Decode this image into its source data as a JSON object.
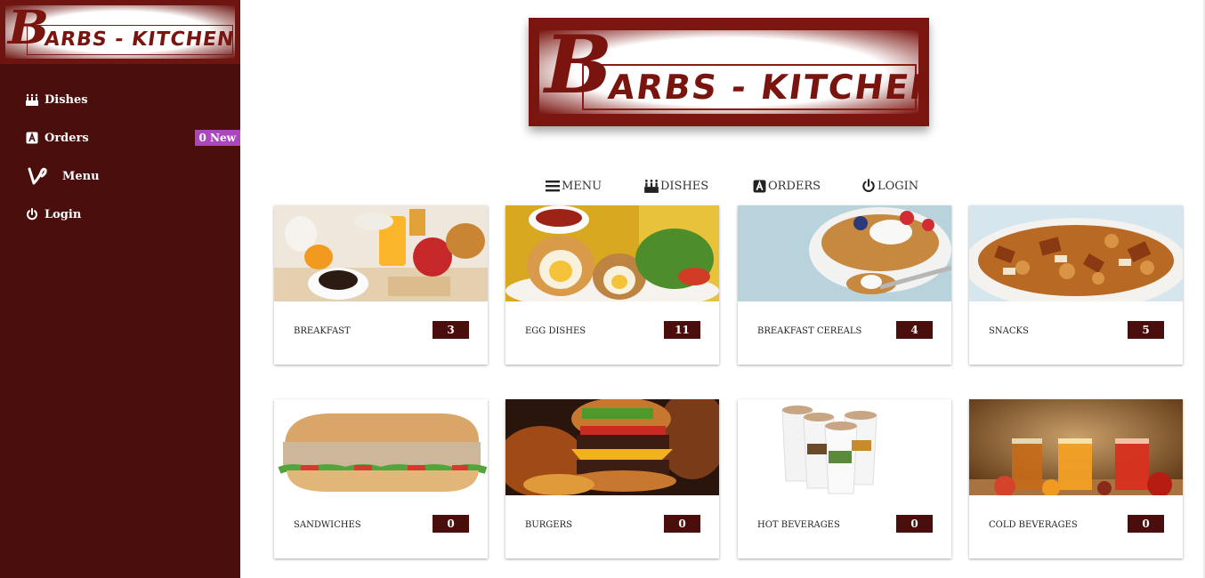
{
  "sidebar": {
    "logo": {
      "letter": "B",
      "text": "ARBS - KITCHEN"
    },
    "items": [
      {
        "label": "Dishes",
        "icon": "birthday-cake-icon"
      },
      {
        "label": "Orders",
        "icon": "letter-a-box-icon",
        "badge": "0 New"
      },
      {
        "label": "Menu",
        "icon": "vine-icon"
      },
      {
        "label": "Login",
        "icon": "power-icon"
      }
    ]
  },
  "header": {
    "logo": {
      "letter": "B",
      "text": "ARBS - KITCHEN"
    }
  },
  "nav": {
    "items": [
      {
        "label": "MENU",
        "icon": "hamburger-icon"
      },
      {
        "label": "DISHES",
        "icon": "birthday-cake-icon"
      },
      {
        "label": "ORDERS",
        "icon": "letter-a-box-icon"
      },
      {
        "label": "LOGIN",
        "icon": "power-icon"
      }
    ]
  },
  "categories": [
    {
      "name": "BREAKFAST",
      "count": "3"
    },
    {
      "name": "EGG DISHES",
      "count": "11"
    },
    {
      "name": "BREAKFAST CEREALS",
      "count": "4"
    },
    {
      "name": "SNACKS",
      "count": "5"
    },
    {
      "name": "SANDWICHES",
      "count": "0"
    },
    {
      "name": "BURGERS",
      "count": "0"
    },
    {
      "name": "HOT BEVERAGES",
      "count": "0"
    },
    {
      "name": "COLD BEVERAGES",
      "count": "0"
    }
  ],
  "colors": {
    "sidebar_bg": "#4a0e0c",
    "logo_bg": "#7a1510",
    "badge_bg": "#ab47bc",
    "count_bg": "#4a0e0c"
  }
}
